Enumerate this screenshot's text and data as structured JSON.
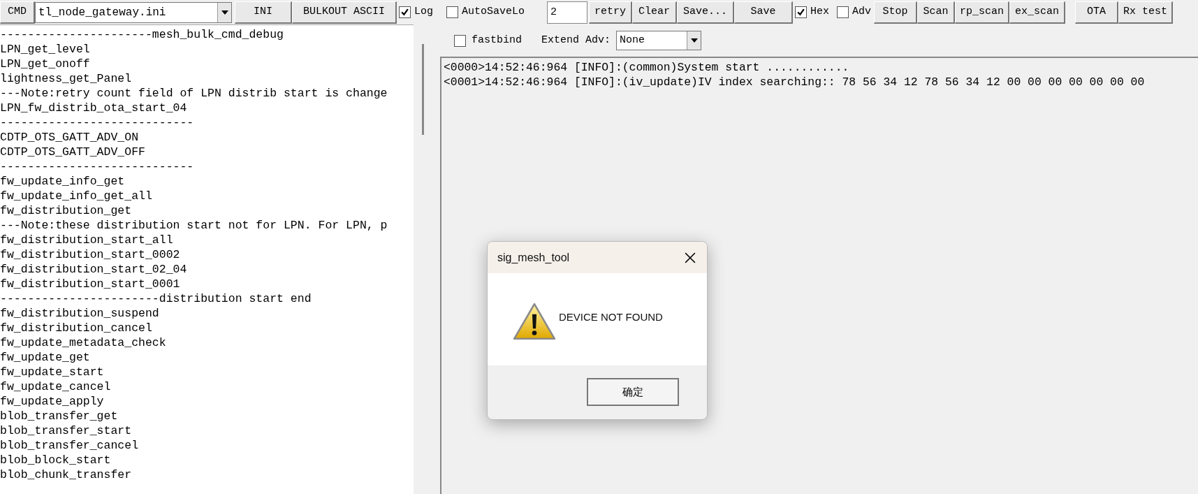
{
  "toolbar": [
    {
      "kind": "button",
      "label": "CMD"
    },
    {
      "kind": "dropdown",
      "value": "tl_node_gateway.ini"
    },
    {
      "kind": "button",
      "label": "INI"
    },
    {
      "kind": "button",
      "label": "BULKOUT ASCII"
    },
    {
      "kind": "checkbox",
      "label": "Log",
      "checked": true
    },
    {
      "kind": "checkbox",
      "label": "AutoSaveLo",
      "checked": false
    },
    {
      "kind": "input",
      "value": "2"
    },
    {
      "kind": "button",
      "label": "retry"
    },
    {
      "kind": "button",
      "label": "Clear"
    },
    {
      "kind": "button",
      "label": "Save..."
    },
    {
      "kind": "button",
      "label": "Save"
    },
    {
      "kind": "checkbox",
      "label": "Hex",
      "checked": true
    },
    {
      "kind": "checkbox",
      "label": "Adv",
      "checked": false
    },
    {
      "kind": "button",
      "label": "Stop"
    },
    {
      "kind": "button",
      "label": "Scan"
    },
    {
      "kind": "button",
      "label": "rp_scan"
    },
    {
      "kind": "button",
      "label": "ex_scan"
    },
    {
      "kind": "button",
      "label": "OTA"
    },
    {
      "kind": "button",
      "label": "Rx test"
    }
  ],
  "options": {
    "fastbind": {
      "label": "fastbind",
      "checked": false
    },
    "extend_adv": {
      "label": "Extend Adv:",
      "value": "None"
    }
  },
  "command_list": [
    "----------------------mesh_bulk_cmd_debug",
    "LPN_get_level",
    "LPN_get_onoff",
    "lightness_get_Panel",
    "---Note:retry count field of LPN distrib start is change",
    "LPN_fw_distrib_ota_start_04",
    "----------------------------",
    "CDTP_OTS_GATT_ADV_ON",
    "CDTP_OTS_GATT_ADV_OFF",
    "----------------------------",
    "fw_update_info_get",
    "fw_update_info_get_all",
    "fw_distribution_get",
    "---Note:these distribution start not for LPN. For LPN, p",
    "fw_distribution_start_all",
    "fw_distribution_start_0002",
    "fw_distribution_start_02_04",
    "fw_distribution_start_0001",
    "-----------------------distribution start end",
    "fw_distribution_suspend",
    "fw_distribution_cancel",
    "fw_update_metadata_check",
    "fw_update_get",
    "fw_update_start",
    "fw_update_cancel",
    "fw_update_apply",
    "blob_transfer_get",
    "blob_transfer_start",
    "blob_transfer_cancel",
    "blob_block_start",
    "blob_chunk_transfer"
  ],
  "log": [
    "<0000>14:52:46:964 [INFO]:(common)System start ............",
    "<0001>14:52:46:964 [INFO]:(iv_update)IV index searching:: 78 56 34 12 78 56 34 12 00 00 00 00 00 00 00"
  ],
  "dialog": {
    "title": "sig_mesh_tool",
    "message": "DEVICE NOT FOUND",
    "button": "确定"
  }
}
